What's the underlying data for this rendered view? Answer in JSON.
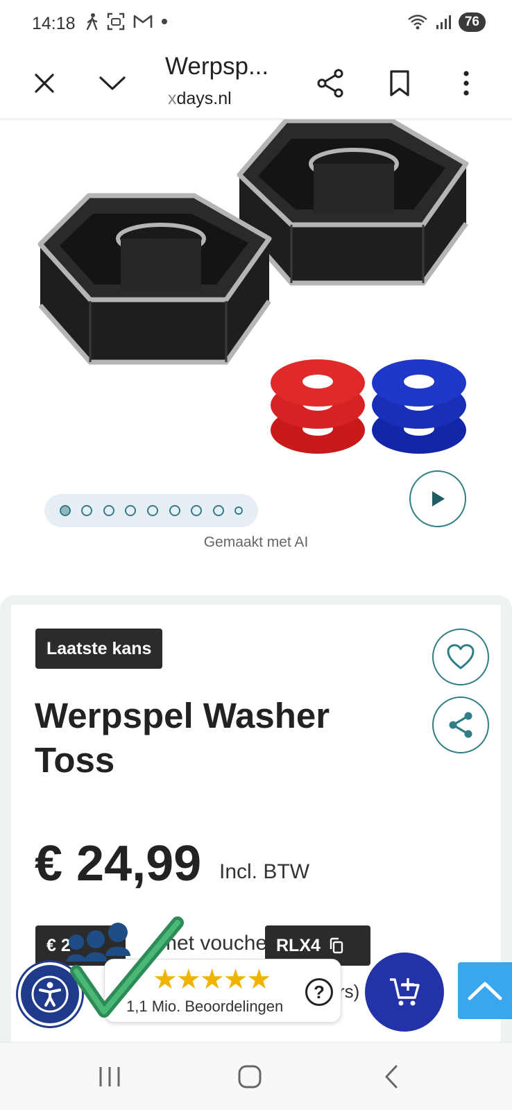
{
  "status_bar": {
    "time": "14:18",
    "battery": "76",
    "icons": [
      "walking-icon",
      "screenshot-icon",
      "gmail-icon",
      "dot-icon",
      "wifi-icon",
      "signal-icon"
    ]
  },
  "browser": {
    "page_title": "Werpsp...",
    "url_prefix": "x",
    "url_rest": "days.nl",
    "buttons": [
      "close-icon",
      "chevron-down-icon",
      "share-icon",
      "bookmark-icon",
      "more-vert-icon"
    ]
  },
  "gallery": {
    "dots_count": 9,
    "active_dot": 1,
    "ai_note": "Gemaakt met AI"
  },
  "product": {
    "badge": "Laatste kans",
    "title": "Werpspel Washer Toss",
    "price": "€ 24,99",
    "price_note": "Incl. BTW",
    "voucher_price_partial": "€ 2",
    "voucher_text_visible": "met voucher",
    "voucher_code": "RLX4",
    "partial_text": "rs)"
  },
  "rating_widget": {
    "stars": "★★★★★",
    "reviews": "1,1 Mio. Beoordelingen",
    "help": "?"
  },
  "colors": {
    "accent_teal": "#2f7d85",
    "cart_blue": "#2432a8",
    "a11y_blue": "#1f3a8a",
    "scroll_top_blue": "#3aa6ee",
    "badge_dark": "#2b2b2b",
    "star_gold": "#f0b400"
  }
}
